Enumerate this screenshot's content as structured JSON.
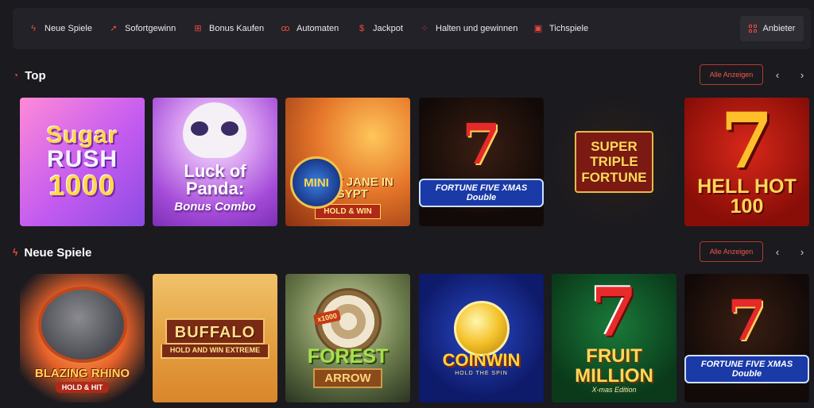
{
  "nav": {
    "items": [
      {
        "label": "Neue Spiele",
        "icon": "lightning-icon"
      },
      {
        "label": "Sofortgewinn",
        "icon": "rocket-icon"
      },
      {
        "label": "Bonus Kaufen",
        "icon": "gift-icon"
      },
      {
        "label": "Automaten",
        "icon": "cherries-icon"
      },
      {
        "label": "Jackpot",
        "icon": "coin-icon"
      },
      {
        "label": "Halten und gewinnen",
        "icon": "dots-grid-icon"
      },
      {
        "label": "Tichspiele",
        "icon": "cards-icon"
      }
    ],
    "provider_label": "Anbieter"
  },
  "sections": {
    "top": {
      "title": "Top",
      "show_all": "Alle Anzeigen",
      "prev": "‹",
      "next": "›"
    },
    "new": {
      "title": "Neue Spiele",
      "show_all": "Alle Anzeigen",
      "prev": "‹",
      "next": "›"
    }
  },
  "top_games": {
    "sugar_rush": {
      "line1": "Sugar",
      "line2": "RUSH",
      "line3": "1000"
    },
    "luck_of_panda": {
      "title": "Luck of Panda:",
      "subtitle": "Bonus Combo"
    },
    "lucky_jane": {
      "mini": "MINI",
      "title": "LUCKY JANE IN EGYPT",
      "badge": "HOLD & WIN"
    },
    "fortune_five_1": {
      "seven": "7",
      "banner": "FORTUNE FIVE XMAS Double"
    },
    "super_triple": {
      "line1": "SUPER",
      "line2": "TRIPLE",
      "line3": "FORTUNE"
    },
    "hell_hot": {
      "seven": "7",
      "title": "HELL HOT 100"
    }
  },
  "new_games": {
    "blazing_rhino": {
      "title": "BLAZING RHINO",
      "badge": "HOLD & HIT"
    },
    "buffalo": {
      "title": "BUFFALO",
      "subtitle": "HOLD AND WIN EXTREME"
    },
    "forest_arrow": {
      "x1000": "x1000",
      "title": "FOREST",
      "subtitle": "ARROW"
    },
    "coin_win": {
      "title": "COINWIN",
      "subtitle": "HOLD THE SPIN"
    },
    "fruit_million": {
      "seven": "7",
      "title": "FRUIT MILLION",
      "subtitle": "X-mas Edition"
    },
    "fortune_five_2": {
      "seven": "7",
      "banner": "FORTUNE FIVE XMAS Double"
    }
  },
  "colors": {
    "accent": "#ef4a3c",
    "background": "#1b1a1f",
    "nav_bg": "#232228"
  }
}
